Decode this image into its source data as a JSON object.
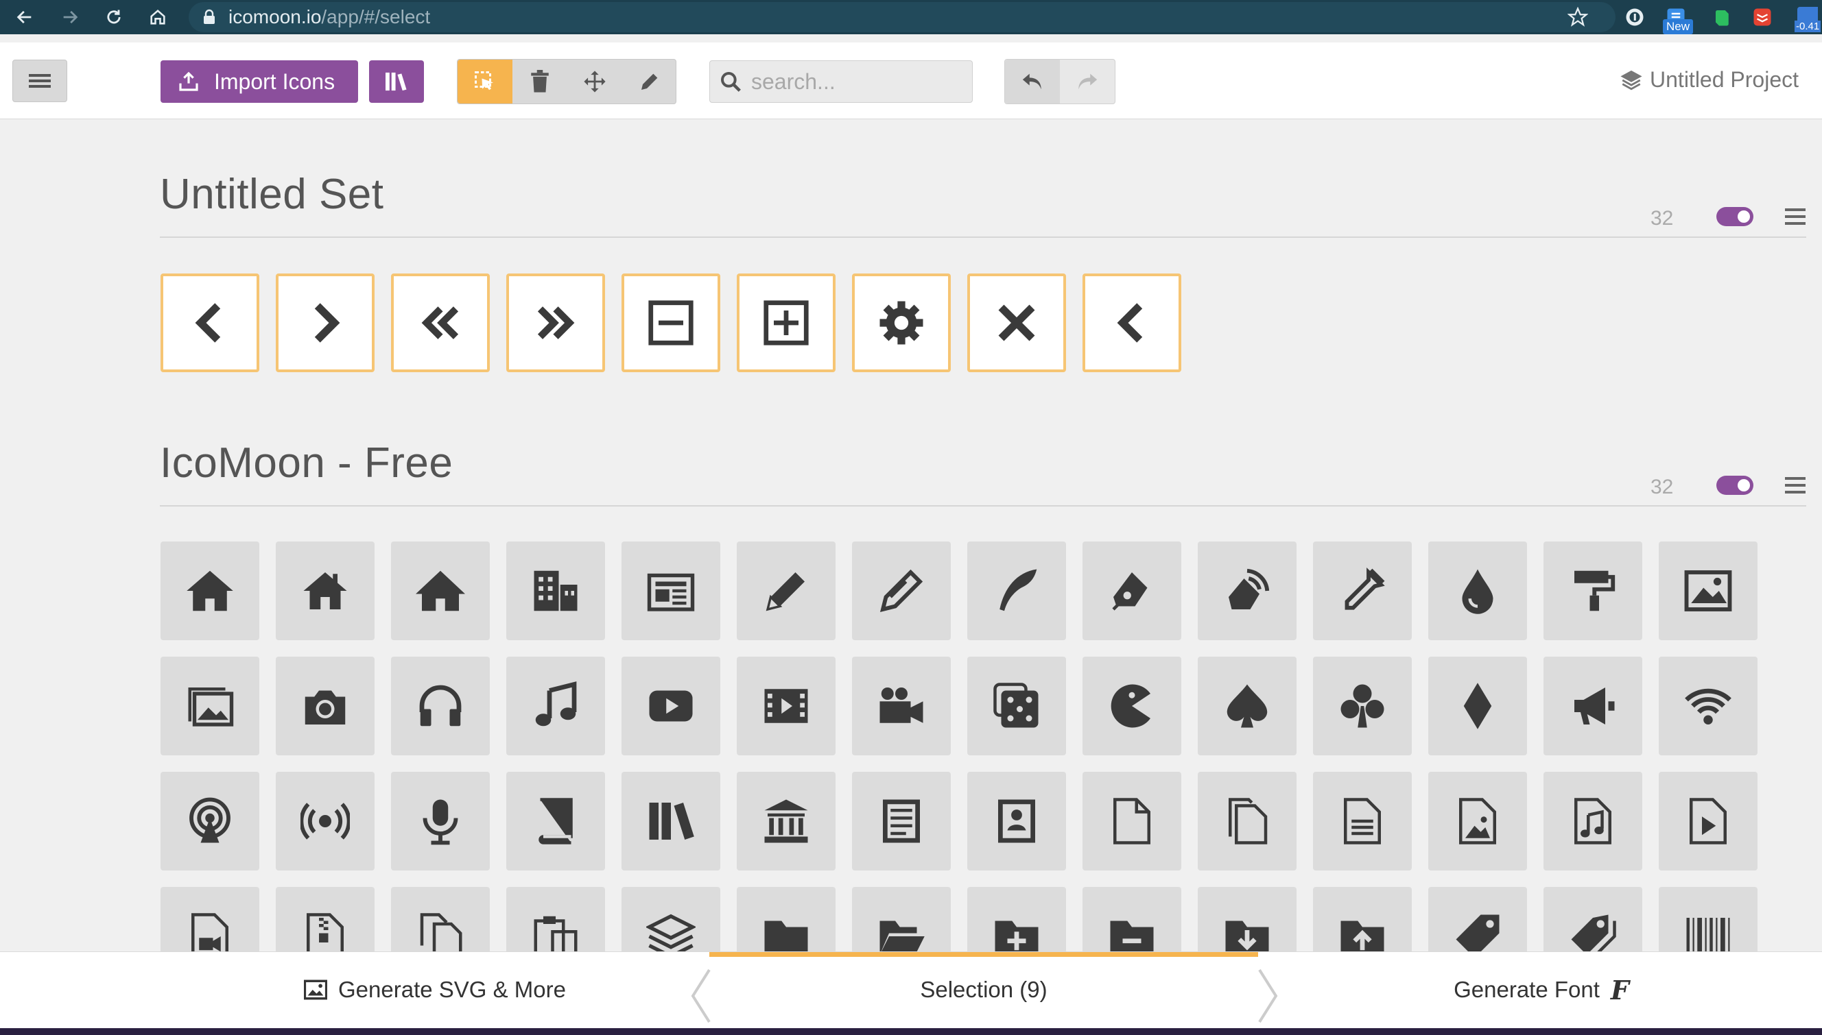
{
  "browser": {
    "url_host": "icomoon.io",
    "url_path": "/app/#/select",
    "new_badge": "New",
    "balance": "-0.41"
  },
  "header": {
    "import_label": "Import Icons",
    "search_placeholder": "search...",
    "project_label": "Untitled Project"
  },
  "sets": [
    {
      "title": "Untitled Set",
      "count": "32",
      "icons": [
        "chevron-left",
        "chevron-right",
        "double-left",
        "double-right",
        "minus-square",
        "plus-square",
        "cog",
        "close",
        "chevron-left"
      ]
    },
    {
      "title": "IcoMoon - Free",
      "count": "32",
      "rows": [
        [
          "home",
          "home2",
          "home3",
          "office",
          "newspaper",
          "pencil",
          "pencil2",
          "quill",
          "pen",
          "blog",
          "eyedropper",
          "droplet",
          "paint-format",
          "image"
        ],
        [
          "images",
          "camera",
          "headphones",
          "music",
          "play",
          "film",
          "video-camera",
          "dice",
          "pacman",
          "spades",
          "clubs",
          "diamonds",
          "bullhorn",
          "connection"
        ],
        [
          "podcast",
          "feed",
          "mic",
          "book",
          "books",
          "library",
          "file-text",
          "profile",
          "file-empty",
          "files-empty",
          "file-text2",
          "file-picture",
          "file-music",
          "file-play"
        ],
        [
          "file-video",
          "file-zip",
          "copy",
          "paste",
          "stack",
          "folder",
          "folder-open",
          "folder-plus",
          "folder-minus",
          "folder-download",
          "folder-upload",
          "price-tag",
          "price-tags",
          "barcode"
        ]
      ]
    }
  ],
  "footer": {
    "generate_svg": "Generate SVG & More",
    "selection": "Selection (9)",
    "generate_font": "Generate Font"
  },
  "colors": {
    "browser_bar": "#1c3f4e",
    "accent_purple": "#8b4f9c",
    "accent_orange": "#f6b44e",
    "tile_grey": "#dcdcdc",
    "selected_border": "#f6c574"
  }
}
